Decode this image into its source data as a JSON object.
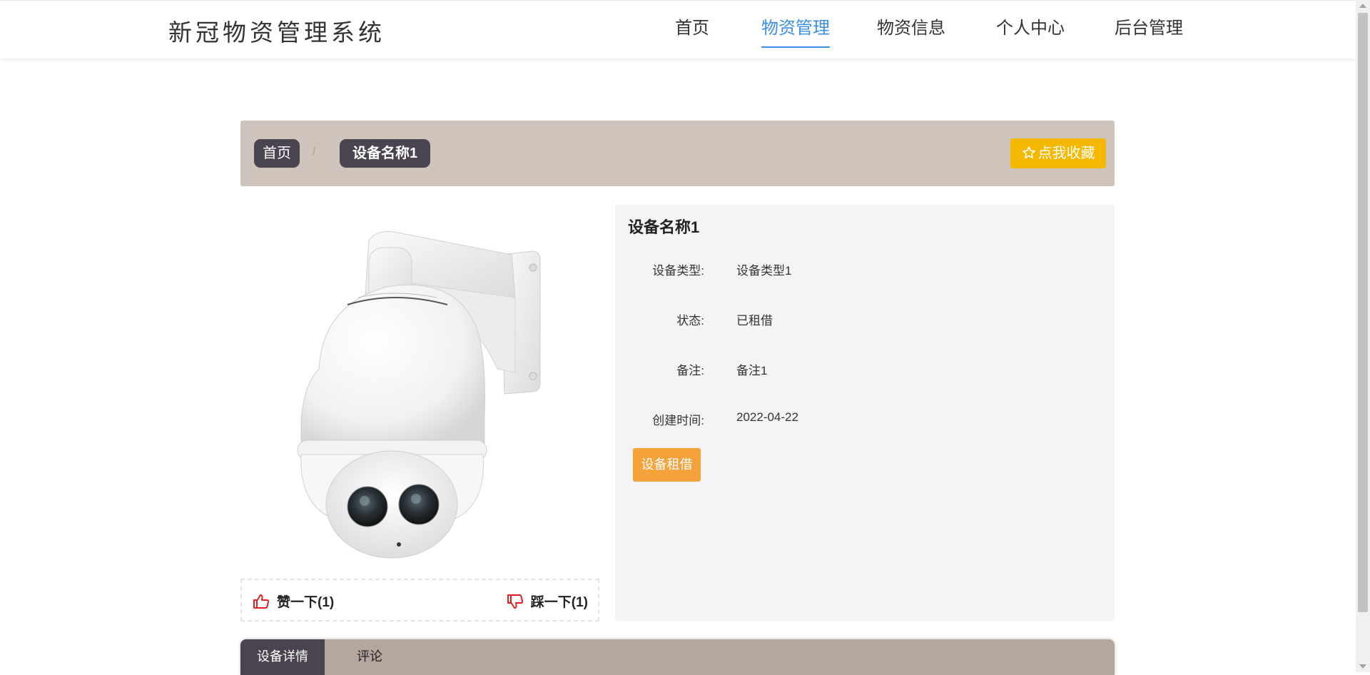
{
  "header": {
    "brand": "新冠物资管理系统",
    "nav": [
      {
        "label": "首页",
        "active": false
      },
      {
        "label": "物资管理",
        "active": true
      },
      {
        "label": "物资信息",
        "active": false
      },
      {
        "label": "个人中心",
        "active": false
      },
      {
        "label": "后台管理",
        "active": false
      }
    ]
  },
  "breadcrumb": {
    "home": "首页",
    "separator": "/",
    "current": "设备名称1"
  },
  "favorite_button": {
    "label": "点我收藏",
    "icon": "star-outline-icon",
    "color": "#f5b800"
  },
  "product": {
    "image_alt": "dome camera",
    "title": "设备名称1",
    "fields": [
      {
        "label": "设备类型:",
        "value": "设备类型1"
      },
      {
        "label": "状态:",
        "value": "已租借"
      },
      {
        "label": "备注:",
        "value": "备注1"
      },
      {
        "label": "创建时间:",
        "value": "2022-04-22"
      }
    ],
    "rent_button": "设备租借"
  },
  "votes": {
    "like_label": "赞一下(1)",
    "dislike_label": "踩一下(1)",
    "icon_color": "#e02020"
  },
  "tabs": [
    {
      "label": "设备详情",
      "active": true
    },
    {
      "label": "评论",
      "active": false
    }
  ],
  "colors": {
    "accent": "#3b8ee6",
    "crumb_bg": "#cfc4bb",
    "dark_chip": "#4a4350",
    "orange": "#f6a23a",
    "tab_bar": "#b5a69e"
  }
}
